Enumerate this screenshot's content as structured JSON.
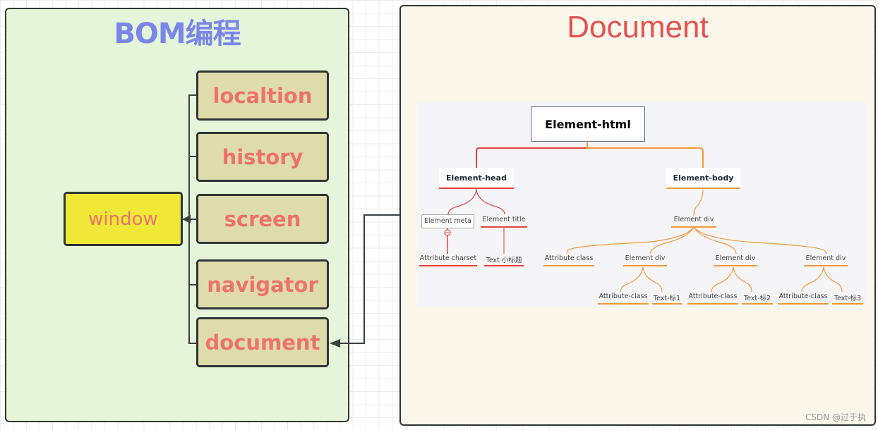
{
  "bom_panel": {
    "title": "BOM编程",
    "root_node": "window",
    "children": [
      "localtion",
      "history",
      "screen",
      "navigator",
      "document"
    ]
  },
  "document_panel": {
    "title": "Document",
    "dom_tree": {
      "root": "Element-html",
      "head": {
        "label": "Element-head",
        "children": [
          {
            "label": "Element meta",
            "children": [
              "Attribute charset"
            ]
          },
          {
            "label": "Element title",
            "children": [
              "Text 小标题"
            ]
          }
        ]
      },
      "body": {
        "label": "Element-body",
        "div": {
          "label": "Element div",
          "children": [
            {
              "label": "Attribute class"
            },
            {
              "label": "Element div",
              "children": [
                "Attribute-class",
                "Text-标1"
              ]
            },
            {
              "label": "Element div",
              "children": [
                "Attribute-class",
                "Text-标2"
              ]
            },
            {
              "label": "Element div",
              "children": [
                "Attribute-class",
                "Text-标3"
              ]
            }
          ]
        }
      }
    }
  },
  "colors": {
    "bom_title": "#7b86ea",
    "document_title": "#e5514f",
    "head_branch": "#e5433e",
    "body_branch": "#f4993a",
    "node_text": "#ee726c"
  },
  "watermark": "CSDN @过于执"
}
